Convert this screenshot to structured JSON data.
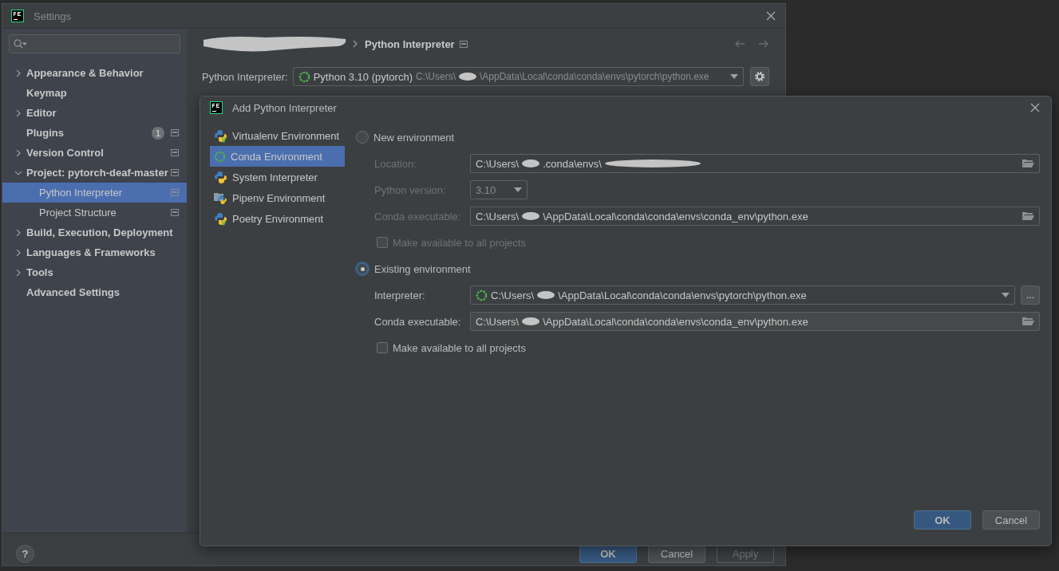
{
  "settings": {
    "title": "Settings",
    "sidebar": {
      "items": [
        {
          "label": "Appearance & Behavior",
          "expandable": true,
          "expanded": false,
          "selected": false,
          "sync_icon": false
        },
        {
          "label": "Keymap",
          "expandable": false,
          "selected": false,
          "sync_icon": false
        },
        {
          "label": "Editor",
          "expandable": true,
          "expanded": false,
          "selected": false,
          "sync_icon": false
        },
        {
          "label": "Plugins",
          "expandable": false,
          "selected": false,
          "badge": "1",
          "sync_icon": true
        },
        {
          "label": "Version Control",
          "expandable": true,
          "expanded": false,
          "selected": false,
          "sync_icon": true
        },
        {
          "label": "Project: pytorch-deaf-master",
          "expandable": true,
          "expanded": true,
          "selected": false,
          "sync_icon": true,
          "children": [
            {
              "label": "Python Interpreter",
              "expandable": false,
              "selected": true,
              "sync_icon": true
            },
            {
              "label": "Project Structure",
              "expandable": false,
              "selected": false,
              "sync_icon": true
            }
          ]
        },
        {
          "label": "Build, Execution, Deployment",
          "expandable": true,
          "expanded": false,
          "selected": false,
          "sync_icon": false
        },
        {
          "label": "Languages & Frameworks",
          "expandable": true,
          "expanded": false,
          "selected": false,
          "sync_icon": false
        },
        {
          "label": "Tools",
          "expandable": true,
          "expanded": false,
          "selected": false,
          "sync_icon": false
        },
        {
          "label": "Advanced Settings",
          "expandable": false,
          "selected": false,
          "sync_icon": false
        }
      ]
    },
    "breadcrumb": {
      "title": "Python Interpreter"
    },
    "interpreter": {
      "label": "Python Interpreter:",
      "name": "Python 3.10 (pytorch)",
      "path": [
        "C:\\Users\\",
        "\\AppData\\Local\\conda\\conda\\envs\\pytorch\\python.exe"
      ]
    },
    "help_label": "?",
    "buttons": [
      {
        "label": "OK",
        "kind": "primary",
        "disabled": false
      },
      {
        "label": "Cancel",
        "kind": "default",
        "disabled": false
      },
      {
        "label": "Apply",
        "kind": "default",
        "disabled": true
      }
    ]
  },
  "dialog": {
    "title": "Add Python Interpreter",
    "env_types": [
      {
        "label": "Virtualenv Environment",
        "kind": "virtualenv",
        "selected": false
      },
      {
        "label": "Conda Environment",
        "kind": "conda",
        "selected": true
      },
      {
        "label": "System Interpreter",
        "kind": "system",
        "selected": false
      },
      {
        "label": "Pipenv Environment",
        "kind": "pipenv",
        "selected": false
      },
      {
        "label": "Poetry Environment",
        "kind": "poetry",
        "selected": false
      }
    ],
    "options": [
      {
        "label": "New environment",
        "selected": false,
        "fields": [
          {
            "kind": "path",
            "label": "Location:",
            "path": [
              "C:\\Users\\",
              ".conda\\envs\\"
            ],
            "trailing_redaction": true
          },
          {
            "kind": "select",
            "label": "Python version:",
            "value": "3.10"
          },
          {
            "kind": "path",
            "label": "Conda executable:",
            "path": [
              "C:\\Users\\",
              "\\AppData\\Local\\conda\\conda\\envs\\conda_env\\python.exe"
            ]
          }
        ],
        "checkbox": {
          "label": "Make available to all projects",
          "checked": false
        }
      },
      {
        "label": "Existing environment",
        "selected": true,
        "fields": [
          {
            "kind": "interpreter",
            "label": "Interpreter:",
            "path": [
              "C:\\Users\\",
              "\\AppData\\Local\\conda\\conda\\envs\\pytorch\\python.exe"
            ],
            "browse_label": "..."
          },
          {
            "kind": "path",
            "label": "Conda executable:",
            "path": [
              "C:\\Users\\",
              "\\AppData\\Local\\conda\\conda\\envs\\conda_env\\python.exe"
            ]
          }
        ],
        "checkbox": {
          "label": "Make available to all projects",
          "checked": false
        }
      }
    ],
    "buttons": [
      {
        "label": "OK",
        "kind": "primary",
        "disabled": false
      },
      {
        "label": "Cancel",
        "kind": "default",
        "disabled": false
      }
    ]
  }
}
